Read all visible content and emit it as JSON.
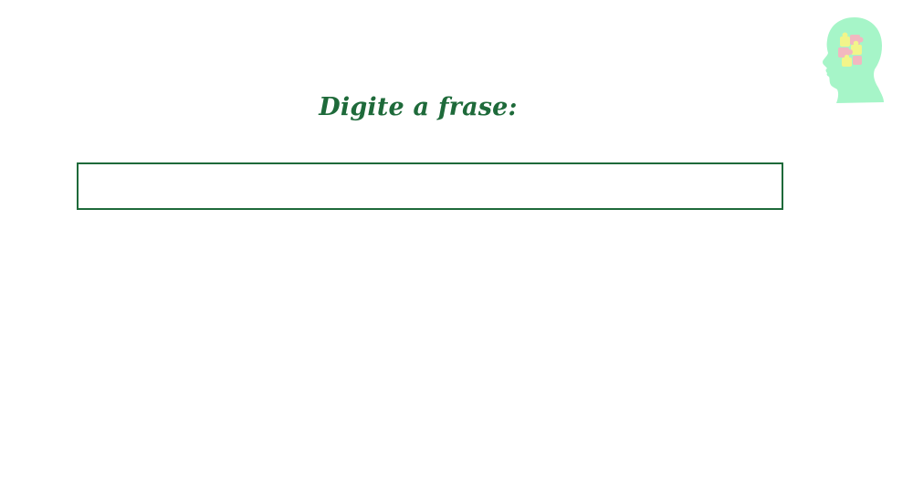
{
  "prompt": {
    "label": "Digite a frase:"
  },
  "input": {
    "value": "",
    "placeholder": ""
  },
  "logo": {
    "icon": "head-puzzle-icon"
  },
  "colors": {
    "text_accent": "#1e6a3a",
    "border": "#1e6a3a",
    "logo_head": "#a6f5c8",
    "logo_puzzle_yellow": "#f2f58a",
    "logo_puzzle_pink": "#f2b8c0",
    "background": "#ffffff"
  }
}
